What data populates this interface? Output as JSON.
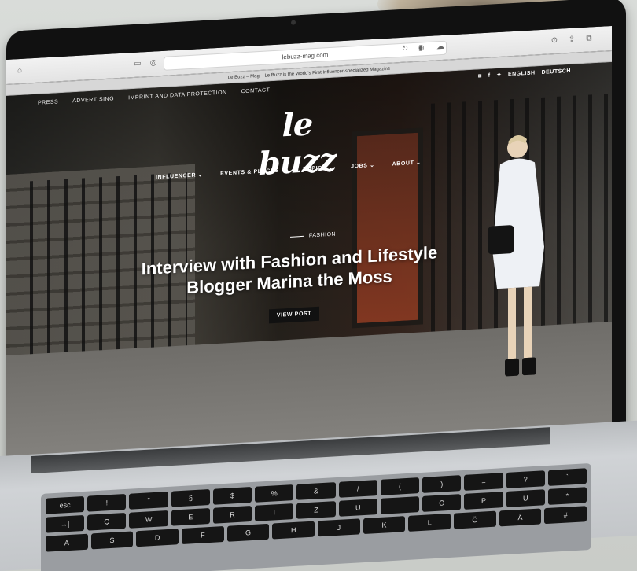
{
  "browser": {
    "url": "lebuzz-mag.com",
    "tab_title": "Le Buzz – Mag – Le Buzz is the World's First Influencer-specialized Magazine"
  },
  "site": {
    "top_nav": [
      "PRESS",
      "ADVERTISING",
      "IMPRINT AND DATA PROTECTION",
      "CONTACT"
    ],
    "languages": [
      "ENGLISH",
      "DEUTSCH"
    ],
    "logo": "le buzz",
    "main_nav": [
      {
        "label": "INFLUENCER",
        "icon": "chevron-down-icon"
      },
      {
        "label": "EVENTS & PLACES",
        "icon": "chevron-down-icon"
      },
      {
        "label": "TOPICS",
        "icon": "chevron-down-icon"
      },
      {
        "label": "JOBS",
        "icon": "chevron-down-icon"
      },
      {
        "label": "ABOUT",
        "icon": "chevron-down-icon"
      }
    ],
    "hero": {
      "category": "FASHION",
      "headline_line1": "Interview with Fashion and Lifestyle",
      "headline_line2": "Blogger Marina the Moss",
      "button": "VIEW POST"
    }
  },
  "keyboard": {
    "row1": [
      "esc",
      "!",
      "\"",
      "§",
      "$",
      "%",
      "&",
      "/",
      "(",
      ")",
      "=",
      "?",
      "`"
    ],
    "row2": [
      "→|",
      "Q",
      "W",
      "E",
      "R",
      "T",
      "Z",
      "U",
      "I",
      "O",
      "P",
      "Ü",
      "*"
    ],
    "row3": [
      "A",
      "S",
      "D",
      "F",
      "G",
      "H",
      "J",
      "K",
      "L",
      "Ö",
      "Ä",
      "#"
    ]
  }
}
